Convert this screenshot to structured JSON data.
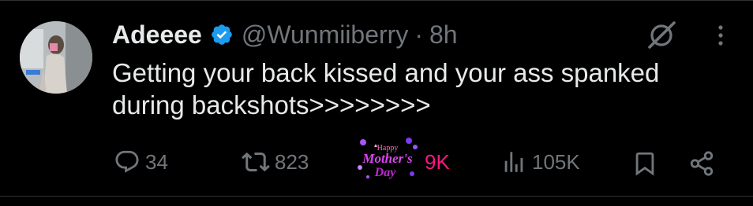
{
  "tweet": {
    "display_name": "Adeeee",
    "handle": "@Wunmiiberry",
    "separator": "·",
    "time": "8h",
    "text": "Getting your back kissed and your ass spanked during backshots>>>>>>>>"
  },
  "actions": {
    "replies": "34",
    "reposts": "823",
    "likes": "9K",
    "views": "105K"
  },
  "sticker": {
    "line1": "Happy",
    "line2": "Mother's",
    "line3": "Day"
  },
  "colors": {
    "background": "#000000",
    "text_primary": "#e7e9ea",
    "text_secondary": "#71767b",
    "verified_blue": "#1d9bf0",
    "like_pink": "#f91880"
  },
  "icons": {
    "verified": "verified-badge-icon",
    "grok": "grok-icon",
    "more": "more-icon",
    "reply": "reply-icon",
    "repost": "repost-icon",
    "views": "views-icon",
    "bookmark": "bookmark-icon",
    "share": "share-icon"
  }
}
